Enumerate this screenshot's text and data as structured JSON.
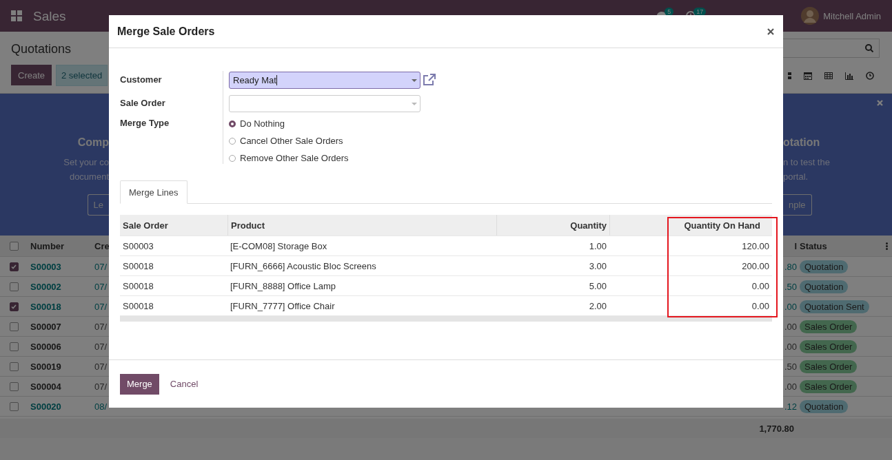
{
  "navbar": {
    "app_name": "Sales",
    "chat_count": "5",
    "activity_count": "17",
    "user": "Mitchell Admin"
  },
  "control_panel": {
    "title": "Quotations",
    "create_button": "Create",
    "selection_badge": "2 selected"
  },
  "banner": {
    "left_fragments": [
      {
        "kind": "title",
        "text": "Comp"
      },
      {
        "kind": "text",
        "text": "Set your co"
      },
      {
        "kind": "text",
        "text": "document"
      },
      {
        "kind": "button",
        "text": "Le"
      }
    ],
    "right_fragments": [
      {
        "kind": "title",
        "text": "otation"
      },
      {
        "kind": "text",
        "text": "n to test the"
      },
      {
        "kind": "text",
        "text": "portal."
      },
      {
        "kind": "button",
        "text": "nple"
      }
    ]
  },
  "list": {
    "all_selected": false,
    "columns": [
      "Number",
      "Cre",
      "l",
      "Status"
    ],
    "rows": [
      {
        "selected": true,
        "number": "S00003",
        "date": "07/",
        "amount": ".80",
        "status": "Quotation",
        "kind": "quotation"
      },
      {
        "selected": false,
        "number": "S00002",
        "date": "07/",
        "amount": ".50",
        "status": "Quotation",
        "kind": "quotation"
      },
      {
        "selected": true,
        "number": "S00018",
        "date": "07/",
        "amount": ".00",
        "status": "Quotation Sent",
        "kind": "quotation"
      },
      {
        "selected": false,
        "number": "S00007",
        "date": "07/",
        "amount": ".00",
        "status": "Sales Order",
        "kind": "sale"
      },
      {
        "selected": false,
        "number": "S00006",
        "date": "07/",
        "amount": ".00",
        "status": "Sales Order",
        "kind": "sale"
      },
      {
        "selected": false,
        "number": "S00019",
        "date": "07/",
        "amount": ".50",
        "status": "Sales Order",
        "kind": "sale"
      },
      {
        "selected": false,
        "number": "S00004",
        "date": "07/",
        "amount": ".00",
        "status": "Sales Order",
        "kind": "sale"
      },
      {
        "selected": false,
        "number": "S00020",
        "date": "08/",
        "amount": ".12",
        "status": "Quotation",
        "kind": "quotation"
      }
    ],
    "total": "1,770.80"
  },
  "dialog": {
    "title": "Merge Sale Orders",
    "fields": [
      {
        "label": "Customer",
        "kind": "select",
        "value": "Ready Mat",
        "focused": true
      },
      {
        "label": "Sale Order",
        "kind": "select",
        "focused": false
      },
      {
        "label": "Merge Type",
        "kind": "radio",
        "options": [
          {
            "label": "Do Nothing",
            "selected": true
          },
          {
            "label": "Cancel Other Sale Orders",
            "selected": false
          },
          {
            "label": "Remove Other Sale Orders",
            "selected": false
          }
        ]
      }
    ],
    "tabs": [
      {
        "label": "Merge Lines",
        "selected": true
      }
    ],
    "table": {
      "columns": [
        {
          "label": "Sale Order",
          "numeric": false,
          "highlighted": false
        },
        {
          "label": "Product",
          "numeric": false,
          "highlighted": false
        },
        {
          "label": "Quantity",
          "numeric": true,
          "highlighted": false
        },
        {
          "label": "Quantity On Hand",
          "numeric": true,
          "highlighted": true
        }
      ],
      "rows": [
        [
          "S00003",
          "[E-COM08] Storage Box",
          "1.00",
          "120.00"
        ],
        [
          "S00018",
          "[FURN_6666] Acoustic Bloc Screens",
          "3.00",
          "200.00"
        ],
        [
          "S00018",
          "[FURN_8888] Office Lamp",
          "5.00",
          "0.00"
        ],
        [
          "S00018",
          "[FURN_7777] Office Chair",
          "2.00",
          "0.00"
        ]
      ]
    },
    "buttons": [
      {
        "label": "Merge",
        "kind": "primary"
      },
      {
        "label": "Cancel",
        "kind": "link"
      }
    ]
  }
}
